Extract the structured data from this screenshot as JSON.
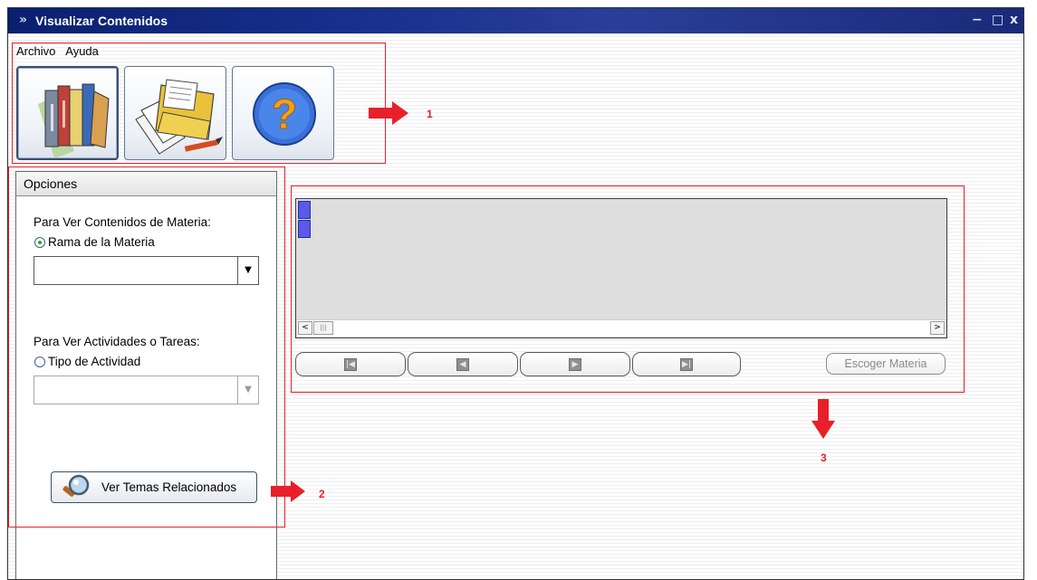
{
  "window": {
    "title": "Visualizar Contenidos",
    "system_icon": "app-icon",
    "controls": {
      "minimize": "−",
      "maximize": "□",
      "close": "x"
    }
  },
  "menu": {
    "items": [
      "Archivo",
      "Ayuda"
    ]
  },
  "toolbar": {
    "buttons": [
      {
        "icon": "books-icon"
      },
      {
        "icon": "folder-documents-icon"
      },
      {
        "icon": "help-question-icon"
      }
    ]
  },
  "annotations": {
    "one": "1",
    "two": "2",
    "three": "3",
    "color": "#e8202a"
  },
  "options": {
    "header": "Opciones",
    "contents_label": "Para Ver Contenidos de Materia:",
    "branch_radio": "Rama de la Materia",
    "branch_value": "",
    "activities_label": "Para Ver Actividades o Tareas:",
    "activity_radio": "Tipo de Actividad",
    "activity_value": "",
    "related_button": "Ver Temas Relacionados"
  },
  "grid": {
    "row_selectors": 2,
    "scroll_left": "<",
    "scroll_right": ">",
    "thumb_grip": "|||"
  },
  "navigation": {
    "first_icon": "first-record-icon",
    "prev_icon": "previous-record-icon",
    "next_icon": "next-record-icon",
    "last_icon": "last-record-icon",
    "choose_button": "Escoger Materia"
  }
}
